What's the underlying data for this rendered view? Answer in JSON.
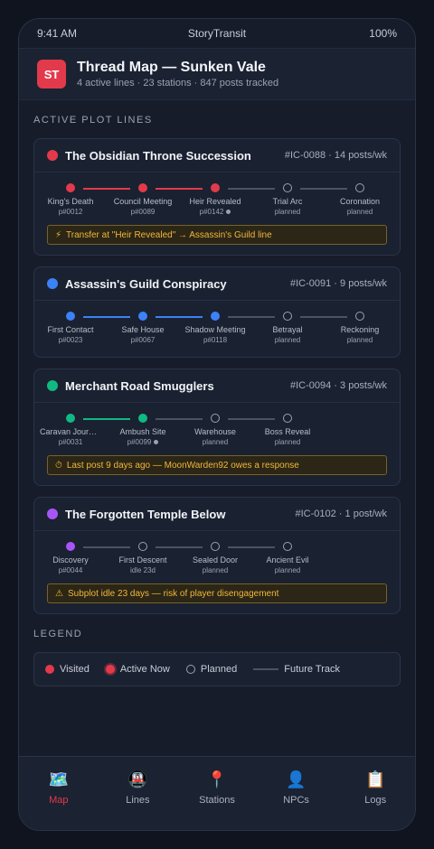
{
  "status": {
    "time": "9:41 AM",
    "carrier": "StoryTransit",
    "battery": "100%"
  },
  "header": {
    "logo": "ST",
    "title": "Thread Map — Sunken Vale",
    "subtitle": "4 active lines · 23 stations · 847 posts tracked"
  },
  "section_active": "ACTIVE PLOT LINES",
  "lines": [
    {
      "title": "The Obsidian Throne Succession",
      "meta": "#IC-0088 · 14 posts/wk",
      "color": "#e23a4b",
      "stations": [
        {
          "name": "King's Death",
          "sub": "p#0012",
          "state": "visited"
        },
        {
          "name": "Council Meeting",
          "sub": "p#0089",
          "state": "visited"
        },
        {
          "name": "Heir Revealed",
          "sub": "p#0142",
          "state": "active"
        },
        {
          "name": "Trial Arc",
          "sub": "planned",
          "state": "planned"
        },
        {
          "name": "Coronation",
          "sub": "planned",
          "state": "planned"
        }
      ],
      "alert": {
        "icon": "⚡",
        "text": "Transfer at \"Heir Revealed\" → Assassin's Guild line"
      }
    },
    {
      "title": "Assassin's Guild Conspiracy",
      "meta": "#IC-0091 · 9 posts/wk",
      "color": "#3b82f6",
      "stations": [
        {
          "name": "First Contact",
          "sub": "p#0023",
          "state": "visited"
        },
        {
          "name": "Safe House",
          "sub": "p#0067",
          "state": "visited"
        },
        {
          "name": "Shadow Meeting",
          "sub": "p#0118",
          "state": "visited"
        },
        {
          "name": "Betrayal",
          "sub": "planned",
          "state": "planned"
        },
        {
          "name": "Reckoning",
          "sub": "planned",
          "state": "planned"
        }
      ]
    },
    {
      "title": "Merchant Road Smugglers",
      "meta": "#IC-0094 · 3 posts/wk",
      "color": "#10b981",
      "stations": [
        {
          "name": "Caravan Journey",
          "sub": "p#0031",
          "state": "visited"
        },
        {
          "name": "Ambush Site",
          "sub": "p#0099",
          "state": "active"
        },
        {
          "name": "Warehouse",
          "sub": "planned",
          "state": "planned"
        },
        {
          "name": "Boss Reveal",
          "sub": "planned",
          "state": "planned"
        }
      ],
      "alert": {
        "icon": "⏱",
        "text": "Last post 9 days ago — MoonWarden92 owes a response"
      }
    },
    {
      "title": "The Forgotten Temple Below",
      "meta": "#IC-0102 · 1 post/wk",
      "color": "#a855f7",
      "stations": [
        {
          "name": "Discovery",
          "sub": "p#0044",
          "state": "visited"
        },
        {
          "name": "First Descent",
          "sub": "idle 23d",
          "state": "planned"
        },
        {
          "name": "Sealed Door",
          "sub": "planned",
          "state": "planned"
        },
        {
          "name": "Ancient Evil",
          "sub": "planned",
          "state": "planned"
        }
      ],
      "alert": {
        "icon": "⚠",
        "text": "Subplot idle 23 days — risk of player disengagement"
      }
    }
  ],
  "section_legend": "LEGEND",
  "legend": {
    "visited": "Visited",
    "active": "Active Now",
    "planned": "Planned",
    "future": "Future Track",
    "accent": "#e23a4b"
  },
  "tabs": [
    {
      "icon": "🗺️",
      "label": "Map"
    },
    {
      "icon": "🚇",
      "label": "Lines"
    },
    {
      "icon": "📍",
      "label": "Stations"
    },
    {
      "icon": "👤",
      "label": "NPCs"
    },
    {
      "icon": "📋",
      "label": "Logs"
    }
  ]
}
